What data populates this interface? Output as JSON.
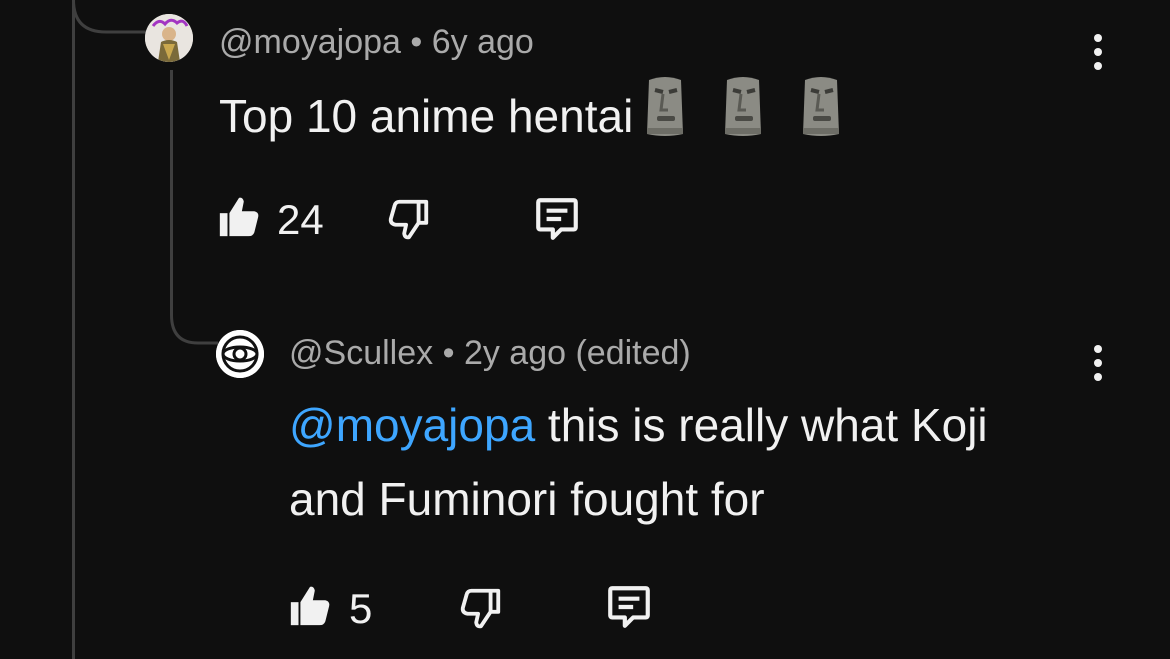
{
  "comment": {
    "author": "@moyajopa",
    "separator": "•",
    "time": "6y ago",
    "text": "Top 10 anime hentai",
    "emoji": [
      "moai-emoji",
      "moai-emoji",
      "moai-emoji"
    ],
    "likes": "24"
  },
  "reply": {
    "author": "@Scullex",
    "separator": "•",
    "time": "2y ago (edited)",
    "mention": "@moyajopa",
    "text": " this is really what Koji and Fuminori fought for",
    "likes": "5"
  },
  "icons": [
    "like-icon",
    "dislike-icon",
    "reply-icon",
    "more-options-icon"
  ],
  "colors": {
    "background": "#0f0f0f",
    "text": "#f1f1f1",
    "meta": "#aaaaaa",
    "mention": "#3ea6ff",
    "thread_line": "#3f3f3f"
  }
}
